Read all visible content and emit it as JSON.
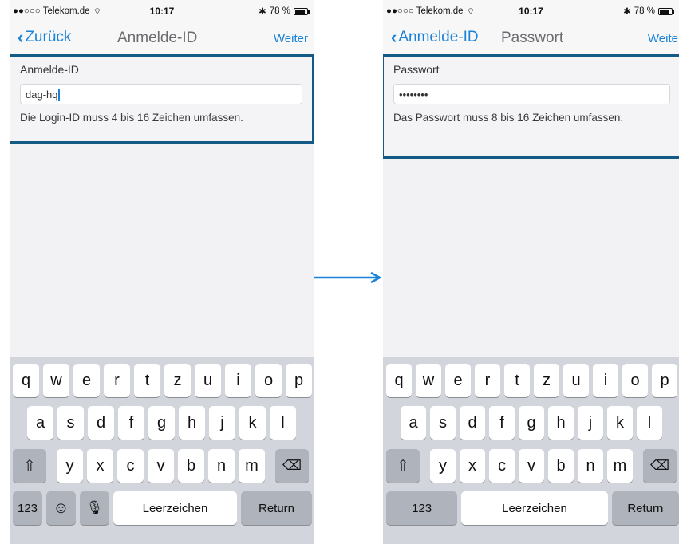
{
  "left": {
    "status": {
      "carrier": "●●○○○ Telekom.de",
      "time": "10:17",
      "battery": "78 %"
    },
    "nav": {
      "back": "Zurück",
      "title": "Anmelde-ID",
      "next": "Weiter"
    },
    "form": {
      "label": "Anmelde-ID",
      "value": "dag-hq",
      "hint": "Die Login-ID muss 4 bis 16 Zeichen umfassen."
    },
    "keyboard": {
      "row1": [
        "q",
        "w",
        "e",
        "r",
        "t",
        "z",
        "u",
        "i",
        "o",
        "p"
      ],
      "row2": [
        "a",
        "s",
        "d",
        "f",
        "g",
        "h",
        "j",
        "k",
        "l"
      ],
      "row3": [
        "y",
        "x",
        "c",
        "v",
        "b",
        "n",
        "m"
      ],
      "numbers": "123",
      "space": "Leerzeichen",
      "return": "Return"
    }
  },
  "right": {
    "status": {
      "carrier": "●●○○○ Telekom.de",
      "time": "10:17",
      "battery": "78 %"
    },
    "nav": {
      "back": "Anmelde-ID",
      "title": "Passwort",
      "next": "Weiter"
    },
    "form": {
      "label": "Passwort",
      "value": "••••••••",
      "hint": "Das Passwort muss 8 bis 16 Zeichen umfassen."
    },
    "keyboard": {
      "row1": [
        "q",
        "w",
        "e",
        "r",
        "t",
        "z",
        "u",
        "i",
        "o",
        "p"
      ],
      "row2": [
        "a",
        "s",
        "d",
        "f",
        "g",
        "h",
        "j",
        "k",
        "l"
      ],
      "row3": [
        "y",
        "x",
        "c",
        "v",
        "b",
        "n",
        "m"
      ],
      "numbers": "123",
      "space": "Leerzeichen",
      "return": "Return"
    }
  },
  "colors": {
    "accent": "#1a82d8",
    "highlight_border": "#135a85",
    "keyboard_bg": "#d2d5db"
  }
}
